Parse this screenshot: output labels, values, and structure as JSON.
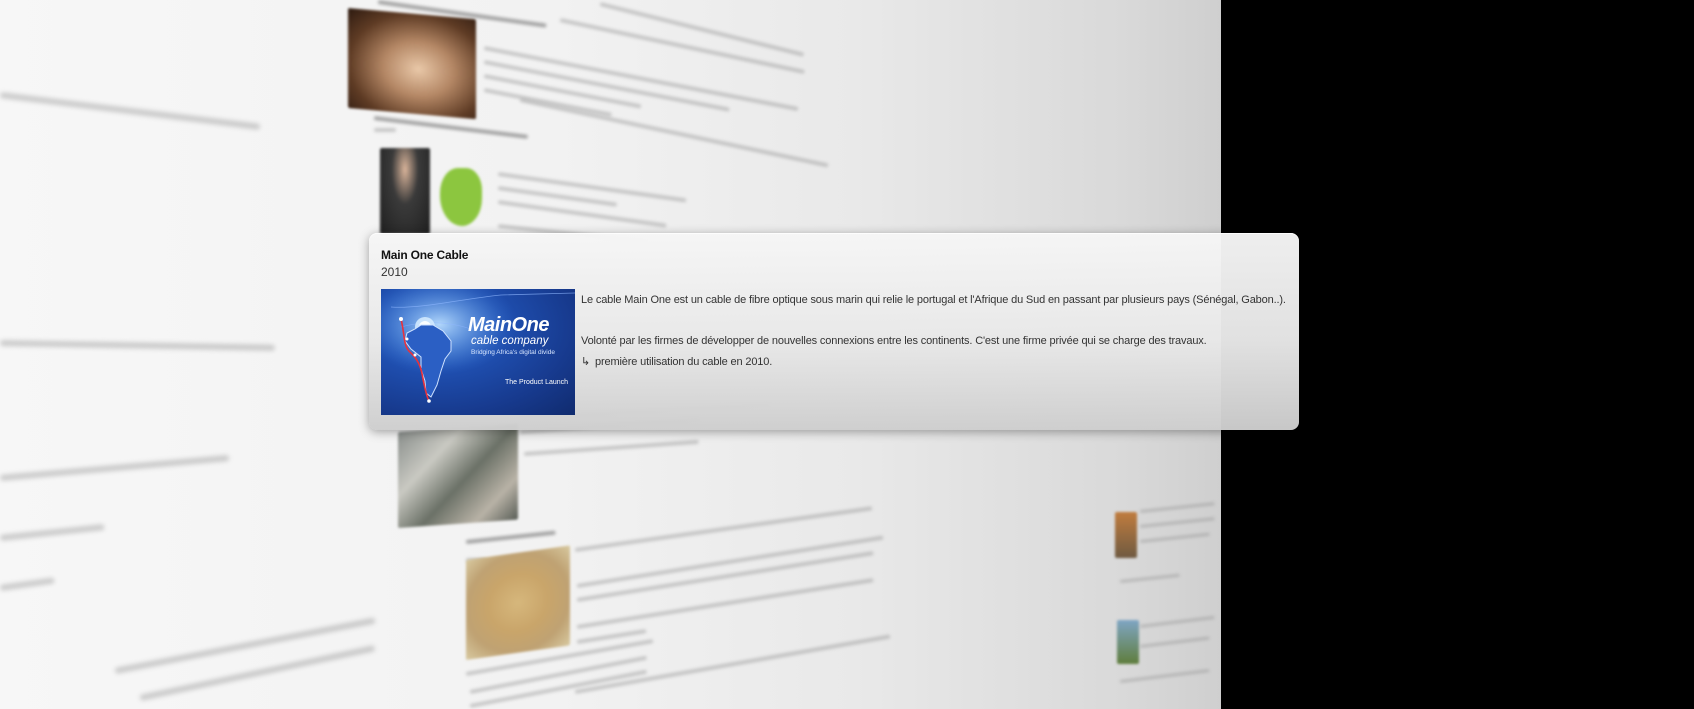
{
  "card": {
    "title": "Main One Cable",
    "year": "2010",
    "image": {
      "brand": "MainOne",
      "subtitle": "cable company",
      "tagline": "Bridging Africa's digital divide",
      "caption": "The Product Launch"
    },
    "paragraph_1": "Le cable Main One est un cable de fibre optique sous marin qui relie le portugal et l'Afrique du Sud en passant par plusieurs pays (Sénégal, Gabon..).",
    "paragraph_2": "Volonté par les firmes de développer de nouvelles connexions entre les continents. C'est une firme privée qui se charge des travaux.",
    "bullet_arrow": "↳",
    "bullet_text": "première utilisation du cable en 2010."
  },
  "colors": {
    "background": "#000000",
    "card_top": "#f6f6f6",
    "card_bottom": "#cecece",
    "thumbnail_blue": "#1f4fb0",
    "route_red": "#e8323c"
  },
  "icons": {
    "bullet": "return-arrow-icon"
  }
}
